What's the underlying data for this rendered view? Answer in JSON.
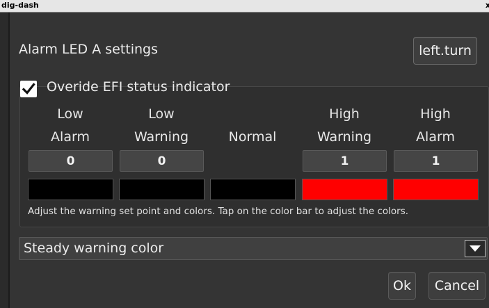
{
  "window": {
    "title": "dig-dash",
    "close_glyph": "x"
  },
  "dialog": {
    "heading": "Alarm LED A settings",
    "turn_button": "left.turn",
    "override": {
      "checked": true,
      "label": "Overide EFI status indicator"
    },
    "columns": [
      {
        "label_line1": "Low",
        "label_line2": "Alarm",
        "value": "0",
        "color": "#000000"
      },
      {
        "label_line1": "Low",
        "label_line2": "Warning",
        "value": "0",
        "color": "#000000"
      },
      {
        "label_line1": "",
        "label_line2": "Normal",
        "value": "",
        "color": "#000000"
      },
      {
        "label_line1": "High",
        "label_line2": "Warning",
        "value": "1",
        "color": "#ff0000"
      },
      {
        "label_line1": "High",
        "label_line2": "Alarm",
        "value": "1",
        "color": "#ff0000"
      }
    ],
    "hint": "Adjust the warning set point and colors. Tap on the color bar to adjust the colors.",
    "warning_mode": {
      "selected": "Steady warning color"
    },
    "ok_button": "Ok",
    "cancel_button": "Cancel"
  },
  "icons": {
    "checkbox": "checkmark-icon",
    "dropdown": "chevron-down-icon"
  }
}
